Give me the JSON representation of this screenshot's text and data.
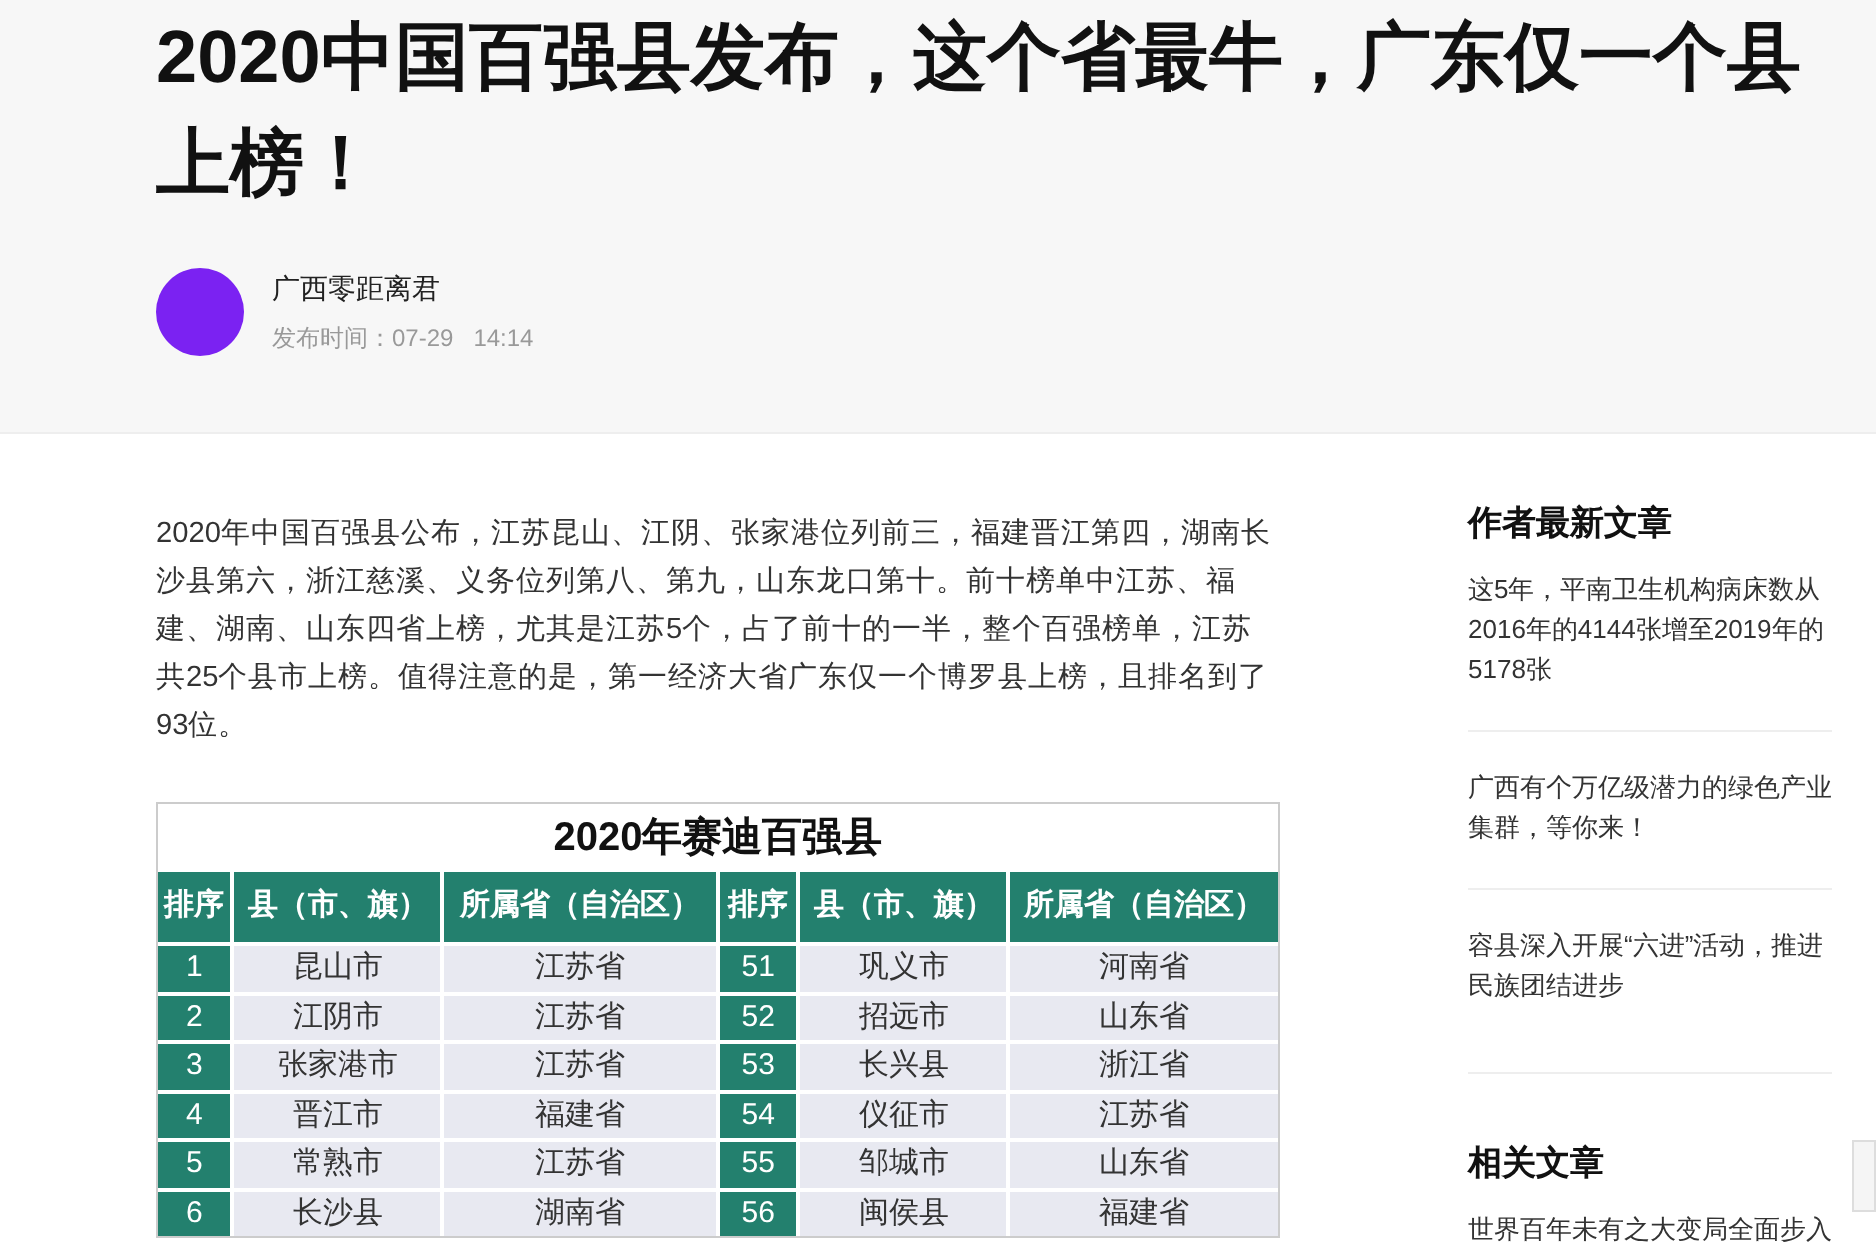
{
  "article": {
    "title": "2020中国百强县发布，这个省最牛，广东仅一个县上榜！",
    "author": "广西零距离君",
    "publish_label": "发布时间：",
    "date": "07-29",
    "time": "14:14",
    "paragraph": "2020年中国百强县公布，江苏昆山、江阴、张家港位列前三，福建晋江第四，湖南长沙县第六，浙江慈溪、义务位列第八、第九，山东龙口第十。前十榜单中江苏、福建、湖南、山东四省上榜，尤其是江苏5个，占了前十的一半，整个百强榜单，江苏共25个县市上榜。值得注意的是，第一经济大省广东仅一个博罗县上榜，且排名到了93位。",
    "table": {
      "title": "2020年赛迪百强县",
      "columns": [
        "排序",
        "县（市、旗）",
        "所属省（自治区）",
        "排序",
        "县（市、旗）",
        "所属省（自治区）"
      ],
      "rows": [
        [
          "1",
          "昆山市",
          "江苏省",
          "51",
          "巩义市",
          "河南省"
        ],
        [
          "2",
          "江阴市",
          "江苏省",
          "52",
          "招远市",
          "山东省"
        ],
        [
          "3",
          "张家港市",
          "江苏省",
          "53",
          "长兴县",
          "浙江省"
        ],
        [
          "4",
          "晋江市",
          "福建省",
          "54",
          "仪征市",
          "江苏省"
        ],
        [
          "5",
          "常熟市",
          "江苏省",
          "55",
          "邹城市",
          "山东省"
        ],
        [
          "6",
          "长沙县",
          "湖南省",
          "56",
          "闽侯县",
          "福建省"
        ]
      ]
    }
  },
  "sidebar": [
    {
      "heading": "作者最新文章",
      "items": [
        "这5年，平南卫生机构病床数从2016年的4144张增至2019年的5178张",
        "广西有个万亿级潜力的绿色产业集群，等你来！",
        "容县深入开展“六进”活动，推进民族团结进步"
      ]
    },
    {
      "heading": "相关文章",
      "items": [
        "世界百年未有之大变局全面步入"
      ]
    }
  ]
}
